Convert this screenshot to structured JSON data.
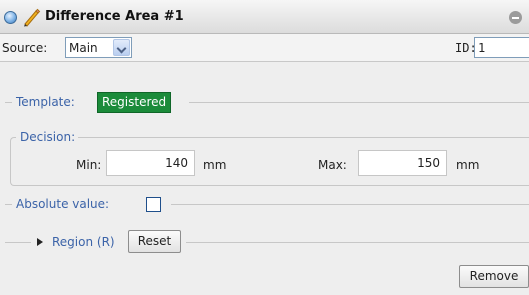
{
  "titlebar": {
    "title": "Difference Area #1",
    "icons": [
      "circle-icon",
      "pencil-icon",
      "collapse-icon"
    ]
  },
  "source": {
    "label": "Source:",
    "selected": "Main",
    "id_label": "ID:",
    "id_value": "1"
  },
  "template": {
    "label": "Template:",
    "status": "Registered",
    "status_color": "#1b8b3a"
  },
  "decision": {
    "label": "Decision:",
    "min_label": "Min:",
    "min_value": "140",
    "min_unit": "mm",
    "max_label": "Max:",
    "max_value": "150",
    "max_unit": "mm"
  },
  "absolute": {
    "label": "Absolute value:",
    "checked": false
  },
  "region": {
    "label": "Region (R)",
    "reset_label": "Reset"
  },
  "footer": {
    "remove_label": "Remove"
  },
  "colors": {
    "legend_text": "#3b63a8",
    "border": "#c7c7c7",
    "background": "#eeeeee"
  }
}
